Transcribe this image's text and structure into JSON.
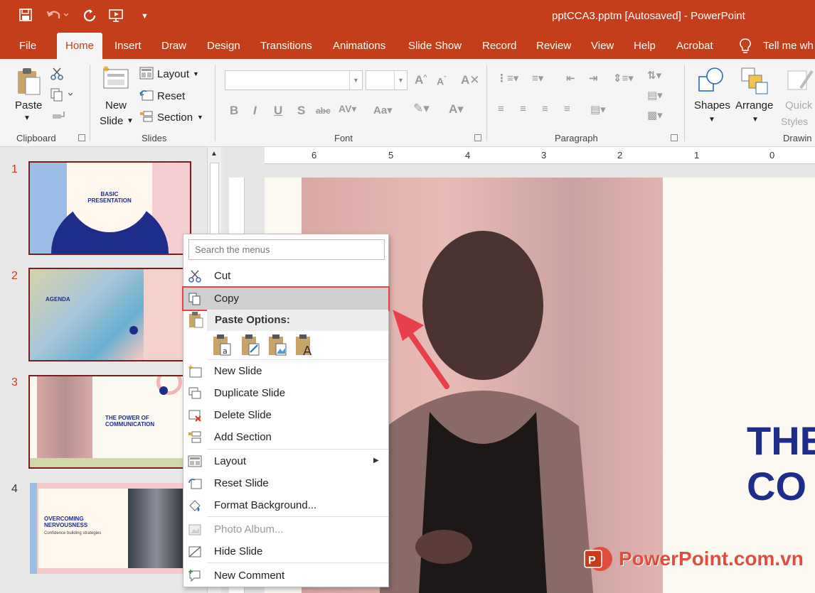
{
  "window": {
    "title": "pptCCA3.pptm [Autosaved]  -  PowerPoint"
  },
  "tabs": [
    "File",
    "Home",
    "Insert",
    "Draw",
    "Design",
    "Transitions",
    "Animations",
    "Slide Show",
    "Record",
    "Review",
    "View",
    "Help",
    "Acrobat"
  ],
  "active_tab": "Home",
  "tell_me": "Tell me wh",
  "ribbon": {
    "clipboard": {
      "paste": "Paste",
      "group": "Clipboard"
    },
    "slides": {
      "new_slide_1": "New",
      "new_slide_2": "Slide",
      "layout": "Layout",
      "reset": "Reset",
      "section": "Section",
      "group": "Slides"
    },
    "font": {
      "group": "Font"
    },
    "paragraph": {
      "group": "Paragraph"
    },
    "drawing": {
      "shapes": "Shapes",
      "arrange": "Arrange",
      "quick_1": "Quick",
      "quick_2": "Styles",
      "group": "Drawin"
    }
  },
  "ruler": {
    "h_numbers": [
      "6",
      "5",
      "4",
      "3",
      "2",
      "1",
      "0"
    ]
  },
  "slides": [
    {
      "num": "1",
      "title_1": "BASIC",
      "title_2": "PRESENTATION"
    },
    {
      "num": "2",
      "title_1": "AGENDA"
    },
    {
      "num": "3",
      "title_1": "THE POWER OF",
      "title_2": "COMMUNICATION"
    },
    {
      "num": "4",
      "title_1": "OVERCOMING",
      "title_2": "NERVOUSNESS",
      "subtitle": "Confidence building strategies"
    }
  ],
  "slide_main": {
    "line_1": "THE",
    "line_2": "CO"
  },
  "context_menu": {
    "search_placeholder": "Search the menus",
    "cut": "Cut",
    "copy": "Copy",
    "paste_options": "Paste Options:",
    "new_slide": "New Slide",
    "duplicate_slide": "Duplicate Slide",
    "delete_slide": "Delete Slide",
    "add_section": "Add Section",
    "layout": "Layout",
    "reset_slide": "Reset Slide",
    "format_background": "Format Background...",
    "photo_album": "Photo Album...",
    "hide_slide": "Hide Slide",
    "new_comment": "New Comment"
  },
  "watermark": {
    "text": "PowerPoint.com.vn"
  },
  "colors": {
    "accent": "#c43e1c",
    "highlight_border": "#e04545",
    "slide_title": "#1e2d8a"
  }
}
